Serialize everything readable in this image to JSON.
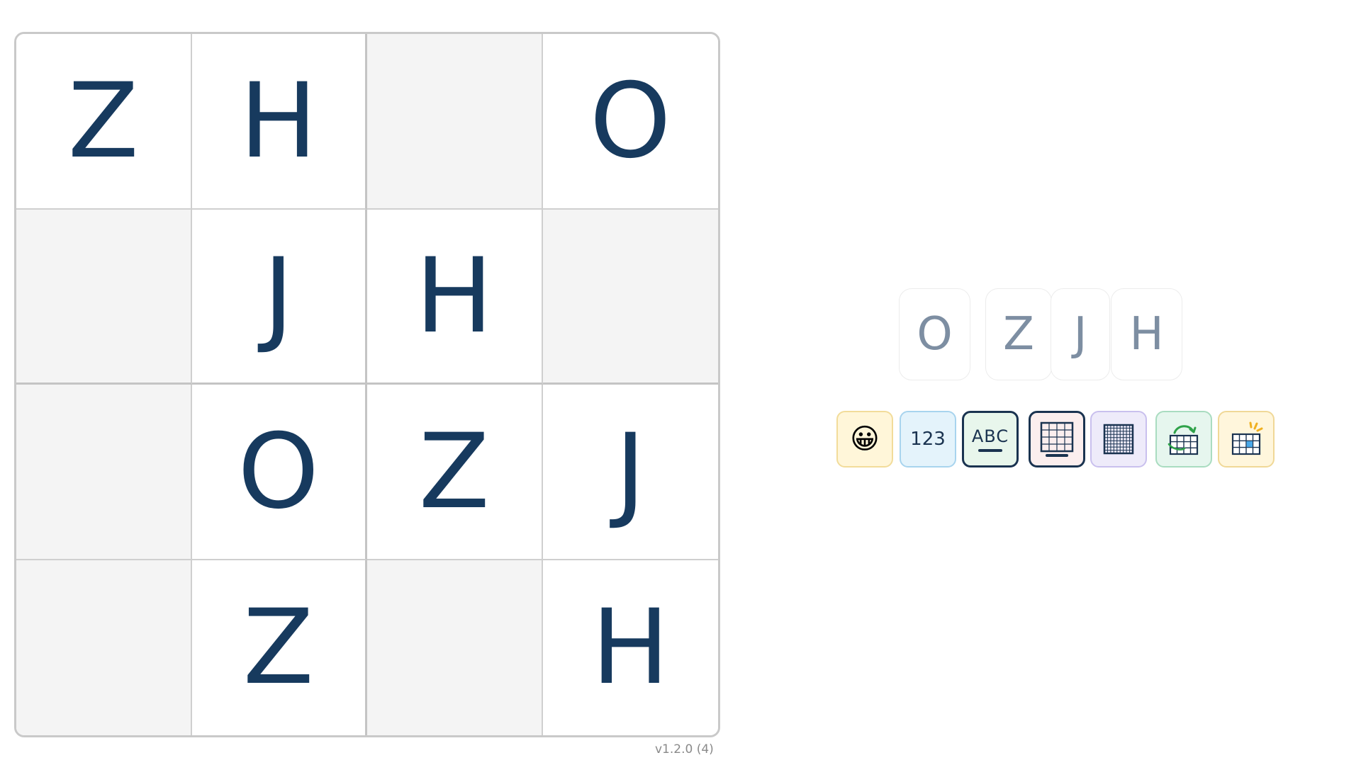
{
  "board": {
    "rows": [
      [
        "Z",
        "H",
        "",
        "O"
      ],
      [
        "",
        "J",
        "H",
        ""
      ],
      [
        "",
        "O",
        "Z",
        "J"
      ],
      [
        "",
        "Z",
        "",
        "H"
      ]
    ]
  },
  "version": "v1.2.0 (4)",
  "palette": {
    "letters": [
      "O",
      "Z",
      "J",
      "H"
    ]
  },
  "tools": {
    "emoji": "😀",
    "numbers": "123",
    "letters": "ABC"
  }
}
